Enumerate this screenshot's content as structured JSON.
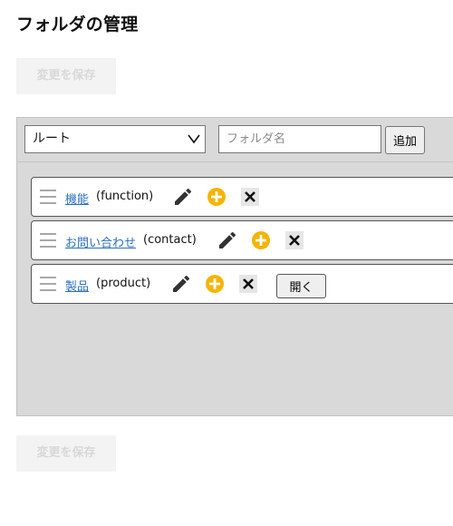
{
  "page": {
    "title": "フォルダの管理",
    "save_label": "変更を保存"
  },
  "toolbar": {
    "select_value": "ルート",
    "name_placeholder": "フォルダ名",
    "add_label": "追加"
  },
  "folders": [
    {
      "label": "機能",
      "key": "(function)",
      "icons": [
        "pencil-icon",
        "add-circle-icon",
        "close-icon"
      ]
    },
    {
      "label": "お問い合わせ",
      "key": "(contact)",
      "icons": [
        "pencil-icon",
        "add-circle-icon",
        "close-icon"
      ]
    },
    {
      "label": "製品",
      "key": "(product)",
      "icons": [
        "pencil-icon",
        "add-circle-icon",
        "close-icon"
      ],
      "open_label": "開く"
    }
  ],
  "colors": {
    "link": "#2a6fbd",
    "add_icon": "#f5b400",
    "panel_bg": "#d9d9d9"
  }
}
